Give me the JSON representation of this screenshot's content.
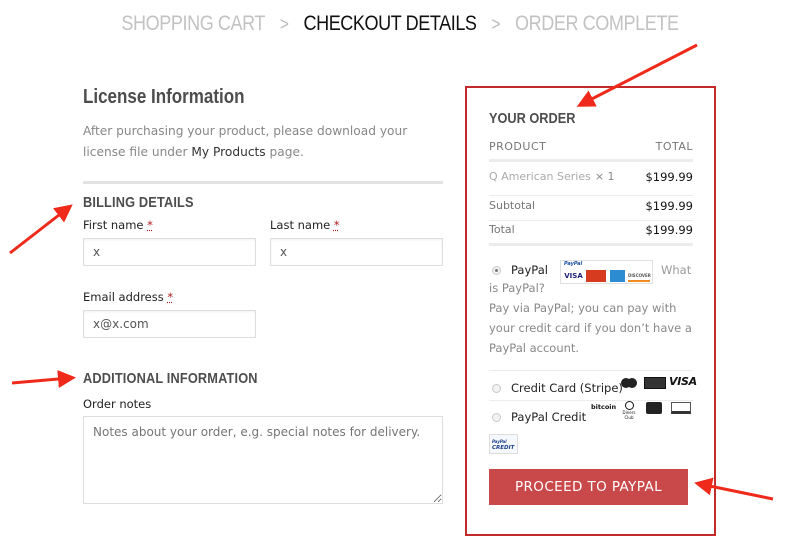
{
  "breadcrumb": {
    "steps": [
      {
        "label": "SHOPPING CART",
        "state": "done"
      },
      {
        "label": "CHECKOUT DETAILS",
        "state": "active"
      },
      {
        "label": "ORDER COMPLETE",
        "state": "upcoming"
      }
    ],
    "separator": ">"
  },
  "license": {
    "title": "License Information",
    "text_before": "After purchasing your product, please download your license file under ",
    "link": "My Products",
    "text_after": " page."
  },
  "billing": {
    "title": "BILLING DETAILS",
    "required_mark": "*",
    "first_name": {
      "label": "First name",
      "value": "x"
    },
    "last_name": {
      "label": "Last name",
      "value": "x"
    },
    "email": {
      "label": "Email address",
      "value": "x@x.com"
    }
  },
  "additional": {
    "title": "ADDITIONAL INFORMATION",
    "notes_label": "Order notes",
    "notes_placeholder": "Notes about your order, e.g. special notes for delivery.",
    "notes_value": ""
  },
  "order": {
    "title": "YOUR ORDER",
    "col_product": "PRODUCT",
    "col_total": "TOTAL",
    "items": [
      {
        "name": "Q American Series",
        "qty": "× 1",
        "total": "$199.99"
      }
    ],
    "subtotal_label": "Subtotal",
    "subtotal": "$199.99",
    "total_label": "Total",
    "total": "$199.99"
  },
  "payment": {
    "selected": "paypal",
    "methods": [
      {
        "id": "paypal",
        "label": "PayPal",
        "logo_brand": "PayPal",
        "cards": [
          "VISA",
          "MasterCard",
          "AMEX",
          "DISCOVER"
        ],
        "what_link": "What is PayPal?",
        "description": "Pay via PayPal; you can pay with your credit card if you don’t have a PayPal account."
      },
      {
        "id": "stripe",
        "label": "Credit Card (Stripe)",
        "cards": [
          "MasterCard",
          "American Express",
          "VISA"
        ]
      },
      {
        "id": "paypal-credit",
        "label": "PayPal Credit",
        "cards": [
          "bitcoin",
          "Diners Club",
          "JCB",
          "Discover"
        ],
        "badge_top": "PayPal",
        "badge_bottom": "CREDIT"
      }
    ]
  },
  "actions": {
    "proceed_label": "PROCEED TO PAYPAL"
  },
  "annotation": {
    "color": "#ef2a1a",
    "box_color": "#c52a2a"
  }
}
